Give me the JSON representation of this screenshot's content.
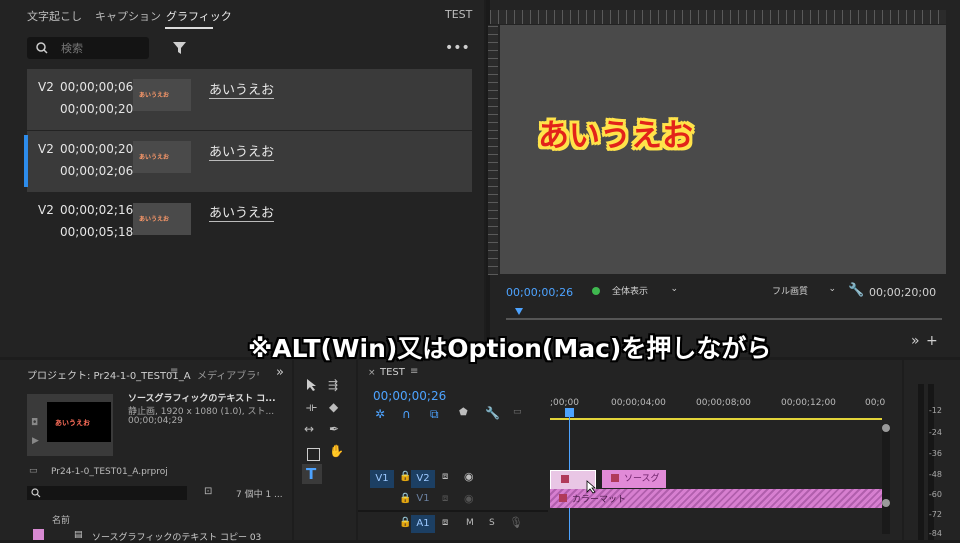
{
  "graphics_panel": {
    "tabs": [
      "文字起こし",
      "キャプション",
      "グラフィック"
    ],
    "right_label": "TEST",
    "search_placeholder": "検索",
    "items": [
      {
        "track": "V2",
        "tc_in": "00;00;00;06",
        "tc_out": "00;00;00;20",
        "thumb_text": "あいうえお",
        "text": "あいうえお"
      },
      {
        "track": "V2",
        "tc_in": "00;00;00;20",
        "tc_out": "00;00;02;06",
        "thumb_text": "あいうえお",
        "text": "あいうえお"
      },
      {
        "track": "V2",
        "tc_in": "00;00;02;16",
        "tc_out": "00;00;05;18",
        "thumb_text": "あいうえお",
        "text": "あいうえお"
      }
    ]
  },
  "program_monitor": {
    "canvas_text": "あいうえお",
    "timecode": "00;00;00;26",
    "zoom": "全体表示",
    "quality": "フル画質",
    "duration": "00;00;20;00"
  },
  "project_panel": {
    "title": "プロジェクト: Pr24-1-0_TEST01_A",
    "tab2": "メディアブラウザ",
    "preview_title": "ソースグラフィックのテキスト コ...",
    "preview_info": "静止画, 1920 x 1080 (1.0), スト...",
    "preview_duration": "00;00;04;29",
    "preview_thumb_text": "あいうえお",
    "project_file": "Pr24-1-0_TEST01_A.prproj",
    "item_count": "7 個中 1 ...",
    "column_name": "名前",
    "list_item": "ソースグラフィックのテキスト コピー 03"
  },
  "timeline": {
    "tab": "TEST",
    "timecode": "00;00;00;26",
    "ruler": [
      ";00;00",
      "00;00;04;00",
      "00;00;08;00",
      "00;00;12;00",
      "00;0"
    ],
    "tracks": [
      {
        "src": "V1",
        "name": "V2"
      },
      {
        "src": "",
        "name": "V1"
      },
      {
        "src": "",
        "name": "A1"
      }
    ],
    "clip_source": "ソースグ",
    "clip_matte": "カラーマット"
  },
  "meter": {
    "levels": [
      "-12",
      "-24",
      "-36",
      "-48",
      "-60",
      "-72",
      "-84"
    ]
  },
  "caption": "※ALT(Win)又はOption(Mac)を押しながら"
}
